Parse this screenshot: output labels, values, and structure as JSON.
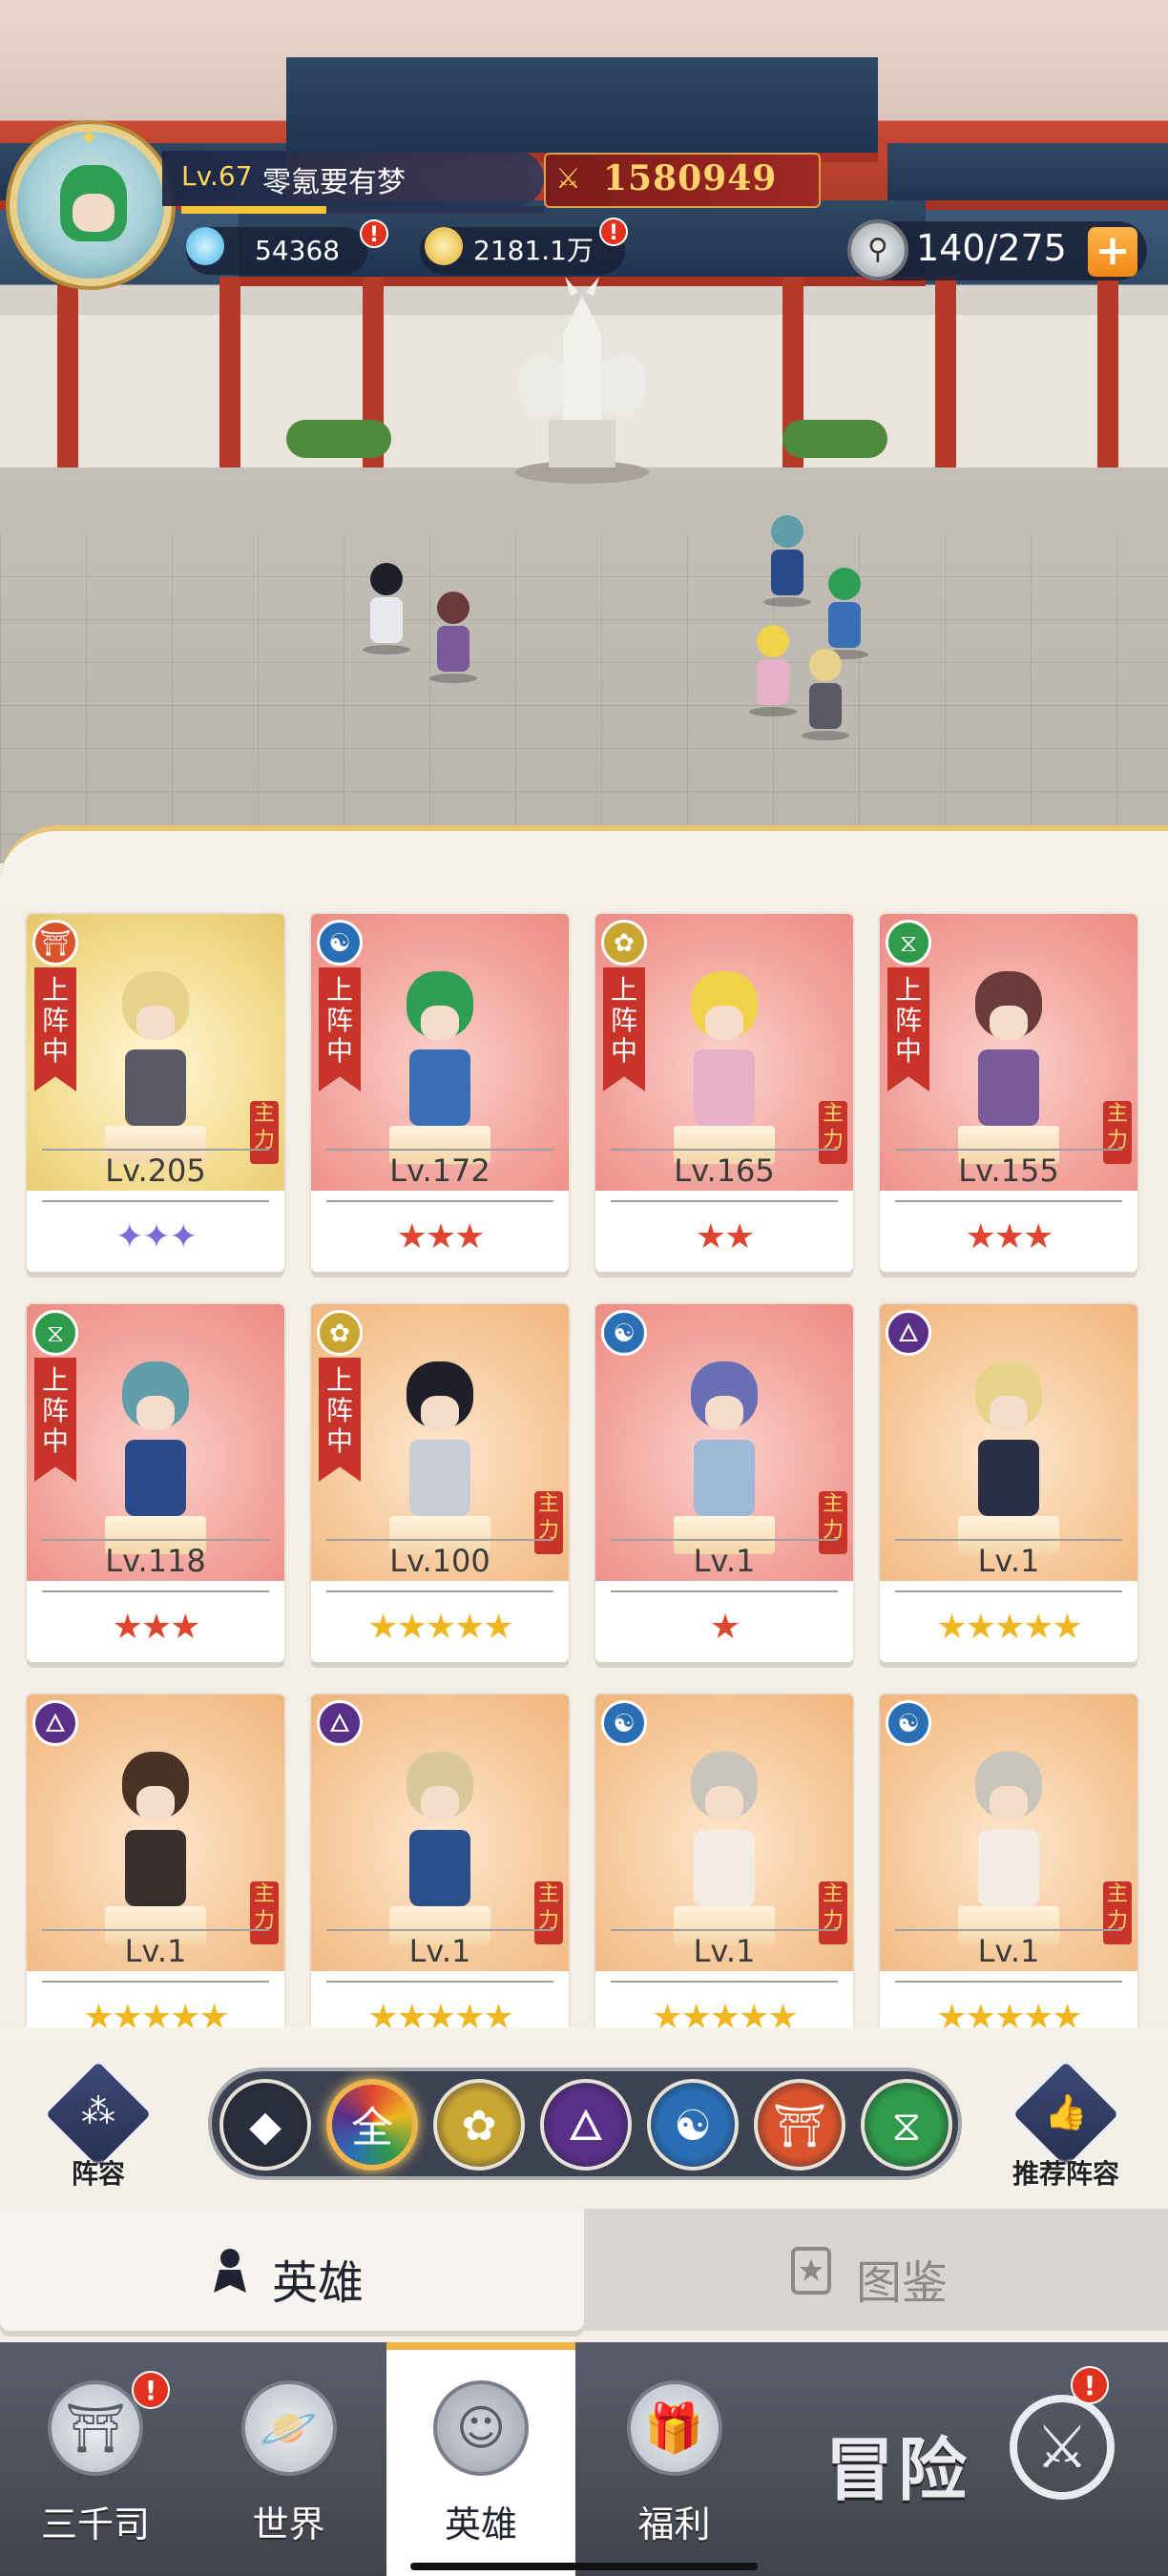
{
  "player": {
    "level": "Lv.67",
    "name": "零氪要有梦",
    "combat_power": "1580949",
    "xp_progress": 0.4,
    "diamonds": "54368",
    "gold": "2181.1万",
    "stamina": "140/275",
    "stamina_add": "+"
  },
  "heroes": [
    {
      "element": "meditation",
      "element_glyph": "⛩",
      "element_color": "#d9542c",
      "bg": "gold",
      "deployed": true,
      "deployed_label": "上阵中",
      "main": true,
      "main_label": "主力",
      "level": "Lv.205",
      "stars": "✦✦✦",
      "stars_color": "#7c6bd6",
      "hair": "#e8d28a",
      "outfit": "#5a5a66"
    },
    {
      "element": "yin-yang",
      "element_glyph": "☯",
      "element_color": "#2a6fb5",
      "bg": "red",
      "deployed": true,
      "deployed_label": "上阵中",
      "main": false,
      "main_label": "",
      "level": "Lv.172",
      "stars": "★★★",
      "stars_color": "#e0452f",
      "hair": "#2f9e55",
      "outfit": "#3b6fb5"
    },
    {
      "element": "lotus",
      "element_glyph": "✿",
      "element_color": "#c9a531",
      "bg": "red",
      "deployed": true,
      "deployed_label": "上阵中",
      "main": true,
      "main_label": "主力",
      "level": "Lv.165",
      "stars": "★★",
      "stars_color": "#e0452f",
      "hair": "#f0d24a",
      "outfit": "#e6b0c8"
    },
    {
      "element": "dna",
      "element_glyph": "⧖",
      "element_color": "#2f9a4a",
      "bg": "red",
      "deployed": true,
      "deployed_label": "上阵中",
      "main": true,
      "main_label": "主力",
      "level": "Lv.155",
      "stars": "★★★",
      "stars_color": "#e0452f",
      "hair": "#6b3a3a",
      "outfit": "#7a5a9a"
    },
    {
      "element": "dna",
      "element_glyph": "⧖",
      "element_color": "#2f9a4a",
      "bg": "red",
      "deployed": true,
      "deployed_label": "上阵中",
      "main": false,
      "main_label": "",
      "level": "Lv.118",
      "stars": "★★★",
      "stars_color": "#e0452f",
      "hair": "#5f9ea8",
      "outfit": "#2a4a8a"
    },
    {
      "element": "lotus",
      "element_glyph": "✿",
      "element_color": "#c9a531",
      "bg": "orange",
      "deployed": true,
      "deployed_label": "上阵中",
      "main": true,
      "main_label": "主力",
      "level": "Lv.100",
      "stars": "★★★★★",
      "stars_color": "#f0b620",
      "hair": "#1f1f2a",
      "outfit": "#c9ccd6"
    },
    {
      "element": "yin-yang",
      "element_glyph": "☯",
      "element_color": "#2a6fb5",
      "bg": "red",
      "deployed": false,
      "deployed_label": "",
      "main": true,
      "main_label": "主力",
      "level": "Lv.1",
      "stars": "★",
      "stars_color": "#e0452f",
      "hair": "#6a6fb5",
      "outfit": "#9fb8d6"
    },
    {
      "element": "flame",
      "element_glyph": "🜂",
      "element_color": "#5a2f8a",
      "bg": "orange",
      "deployed": false,
      "deployed_label": "",
      "main": false,
      "main_label": "",
      "level": "Lv.1",
      "stars": "★★★★★",
      "stars_color": "#f0b620",
      "hair": "#e8d28a",
      "outfit": "#2a2f45"
    },
    {
      "element": "flame",
      "element_glyph": "🜂",
      "element_color": "#5a2f8a",
      "bg": "orange",
      "deployed": false,
      "deployed_label": "",
      "main": true,
      "main_label": "主力",
      "level": "Lv.1",
      "stars": "★★★★★",
      "stars_color": "#f0b620",
      "hair": "#4a3025",
      "outfit": "#3a2f2f"
    },
    {
      "element": "flame",
      "element_glyph": "🜂",
      "element_color": "#5a2f8a",
      "bg": "orange",
      "deployed": false,
      "deployed_label": "",
      "main": true,
      "main_label": "主力",
      "level": "Lv.1",
      "stars": "★★★★★",
      "stars_color": "#f0b620",
      "hair": "#d8c89a",
      "outfit": "#2a4f8a"
    },
    {
      "element": "yin-yang",
      "element_glyph": "☯",
      "element_color": "#2a6fb5",
      "bg": "orange",
      "deployed": false,
      "deployed_label": "",
      "main": true,
      "main_label": "主力",
      "level": "Lv.1",
      "stars": "★★★★★",
      "stars_color": "#f0b620",
      "hair": "#c9c4bc",
      "outfit": "#f2ece4"
    },
    {
      "element": "yin-yang",
      "element_glyph": "☯",
      "element_color": "#2a6fb5",
      "bg": "orange",
      "deployed": false,
      "deployed_label": "",
      "main": true,
      "main_label": "主力",
      "level": "Lv.1",
      "stars": "★★★★★",
      "stars_color": "#f0b620",
      "hair": "#c9c4bc",
      "outfit": "#f2ece4"
    }
  ],
  "filter_bar": {
    "formation_label": "阵容",
    "recommend_label": "推荐阵容",
    "buttons": [
      {
        "id": "rank",
        "glyph": "◆",
        "color": "#2a2f3d",
        "active": false
      },
      {
        "id": "all",
        "glyph": "全",
        "color": "#6a5a3a",
        "active": true
      },
      {
        "id": "lotus",
        "glyph": "✿",
        "color": "#c9a531",
        "active": false
      },
      {
        "id": "flame",
        "glyph": "🜂",
        "color": "#5a2f8a",
        "active": false
      },
      {
        "id": "yin-yang",
        "glyph": "☯",
        "color": "#2a6fb5",
        "active": false
      },
      {
        "id": "meditation",
        "glyph": "⛩",
        "color": "#d9542c",
        "active": false
      },
      {
        "id": "dna",
        "glyph": "⧖",
        "color": "#2f9a4a",
        "active": false
      }
    ]
  },
  "sub_tabs": {
    "heroes_label": "英雄",
    "codex_label": "图鉴"
  },
  "bottom_nav": {
    "items": [
      {
        "label": "三千司",
        "glyph": "⛩",
        "badge": "!"
      },
      {
        "label": "世界",
        "glyph": "🪐",
        "badge": ""
      },
      {
        "label": "英雄",
        "glyph": "☺",
        "badge": ""
      },
      {
        "label": "福利",
        "glyph": "🎁",
        "badge": ""
      }
    ],
    "adventure_label": "冒险",
    "adventure_badge": "!",
    "alert": "!"
  },
  "colors": {
    "accent_gold": "#f0b54a",
    "alert_red": "#e0321f",
    "ribbon_red": "#c8342a"
  }
}
